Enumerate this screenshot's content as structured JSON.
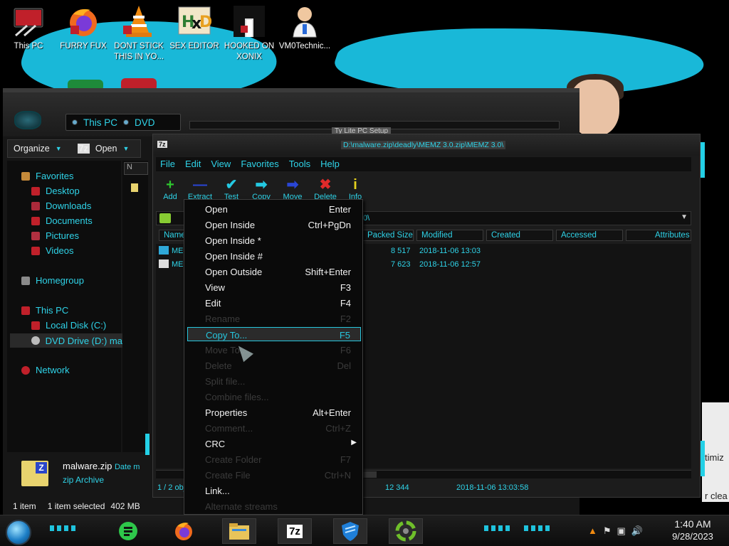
{
  "desktop_icons": [
    {
      "label": "This PC",
      "icon": "computer-icon"
    },
    {
      "label": "FURRY FUX",
      "icon": "firefox-icon"
    },
    {
      "label": "DONT STICK THIS IN YO...",
      "icon": "vlc-cone-icon"
    },
    {
      "label": "SEX EDITOR",
      "icon": "hxd-editor-icon"
    },
    {
      "label": "HOOKED ON XONIX",
      "icon": "xonix-game-icon"
    },
    {
      "label": "VM0Technic...",
      "icon": "doctor-avatar-icon"
    }
  ],
  "explorer": {
    "breadcrumb": [
      "This PC",
      "DVD"
    ],
    "title_fragment": "Ty Lite PC Setup",
    "command_bar": {
      "organize": "Organize",
      "open": "Open",
      "zip_badge": "7z"
    },
    "nav_header": "N",
    "nav": {
      "favorites": "Favorites",
      "favorites_items": [
        "Desktop",
        "Downloads",
        "Documents",
        "Pictures",
        "Videos"
      ],
      "homegroup": "Homegroup",
      "this_pc": "This PC",
      "this_pc_items": [
        "Local Disk (C:)",
        "DVD Drive (D:) ma"
      ],
      "network": "Network"
    },
    "details": {
      "name": "malware.zip",
      "date_label": "Date m",
      "type": "zip Archive",
      "icon_letter": "Z"
    },
    "status": {
      "items": "1 item",
      "selected": "1 item selected",
      "size": "402 MB"
    }
  },
  "zip": {
    "title_badge": "7z",
    "path": "D:\\malware.zip\\deadly\\MEMZ 3.0.zip\\MEMZ 3.0\\",
    "menu": [
      "File",
      "Edit",
      "View",
      "Favorites",
      "Tools",
      "Help"
    ],
    "toolbar": [
      {
        "label": "Add",
        "icon": "plus-icon",
        "glyph": "+",
        "color": "#2ec62e"
      },
      {
        "label": "Extract",
        "icon": "minus-icon",
        "glyph": "—",
        "color": "#2a46d6"
      },
      {
        "label": "Test",
        "icon": "check-icon",
        "glyph": "✔",
        "color": "#24c9e2"
      },
      {
        "label": "Copy",
        "icon": "copy-arrow-icon",
        "glyph": "➡",
        "color": "#24c9e2"
      },
      {
        "label": "Move",
        "icon": "move-arrow-icon",
        "glyph": "➡",
        "color": "#2a46d6"
      },
      {
        "label": "Delete",
        "icon": "delete-x-icon",
        "glyph": "✖",
        "color": "#e02a2a"
      },
      {
        "label": "Info",
        "icon": "info-icon",
        "glyph": "i",
        "color": "#e6d21e"
      }
    ],
    "address_tail": "0\\",
    "columns": [
      "Name",
      "Packed Size",
      "Modified",
      "Created",
      "Accessed",
      "Attributes"
    ],
    "files": [
      {
        "name": "ME",
        "packed": "8 517",
        "modified": "2018-11-06 13:03"
      },
      {
        "name": "ME",
        "packed": "7 623",
        "modified": "2018-11-06 12:57"
      }
    ],
    "status": {
      "objects": "1 / 2 obj",
      "size": "12 344",
      "date": "2018-11-06 13:03:58"
    }
  },
  "context_menu": [
    {
      "label": "Open",
      "shortcut": "Enter",
      "disabled": false
    },
    {
      "label": "Open Inside",
      "shortcut": "Ctrl+PgDn",
      "disabled": false
    },
    {
      "label": "Open Inside *",
      "shortcut": "",
      "disabled": false
    },
    {
      "label": "Open Inside #",
      "shortcut": "",
      "disabled": false
    },
    {
      "label": "Open Outside",
      "shortcut": "Shift+Enter",
      "disabled": false
    },
    {
      "label": "View",
      "shortcut": "F3",
      "disabled": false
    },
    {
      "label": "Edit",
      "shortcut": "F4",
      "disabled": false
    },
    {
      "label": "Rename",
      "shortcut": "F2",
      "disabled": true
    },
    {
      "label": "Copy To...",
      "shortcut": "F5",
      "disabled": false,
      "highlighted": true
    },
    {
      "label": "Move To...",
      "shortcut": "F6",
      "disabled": true
    },
    {
      "label": "Delete",
      "shortcut": "Del",
      "disabled": true
    },
    {
      "label": "Split file...",
      "shortcut": "",
      "disabled": true
    },
    {
      "label": "Combine files...",
      "shortcut": "",
      "disabled": true
    },
    {
      "label": "Properties",
      "shortcut": "Alt+Enter",
      "disabled": false
    },
    {
      "label": "Comment...",
      "shortcut": "Ctrl+Z",
      "disabled": true
    },
    {
      "label": "CRC",
      "shortcut": "",
      "disabled": false,
      "submenu": true
    },
    {
      "label": "Create Folder",
      "shortcut": "F7",
      "disabled": true
    },
    {
      "label": "Create File",
      "shortcut": "Ctrl+N",
      "disabled": true
    },
    {
      "label": "Link...",
      "shortcut": "",
      "disabled": false
    },
    {
      "label": "Alternate streams",
      "shortcut": "",
      "disabled": true
    }
  ],
  "right_window_fragments": [
    "timiz",
    "r clea"
  ],
  "taskbar": {
    "apps": [
      {
        "name": "green-app-icon",
        "color": "#2ec64a"
      },
      {
        "name": "firefox-icon",
        "color": "#f06a1e"
      },
      {
        "name": "file-explorer-icon",
        "color": "#e8c45a"
      },
      {
        "name": "7zip-icon",
        "color": "#ffffff"
      },
      {
        "name": "shield-app-icon",
        "color": "#1f7fd8"
      },
      {
        "name": "recycle-app-icon",
        "color": "#6fbf2a"
      }
    ],
    "zip_badge": "7z",
    "clock_time": "1:40 AM",
    "clock_date": "9/28/2023"
  }
}
